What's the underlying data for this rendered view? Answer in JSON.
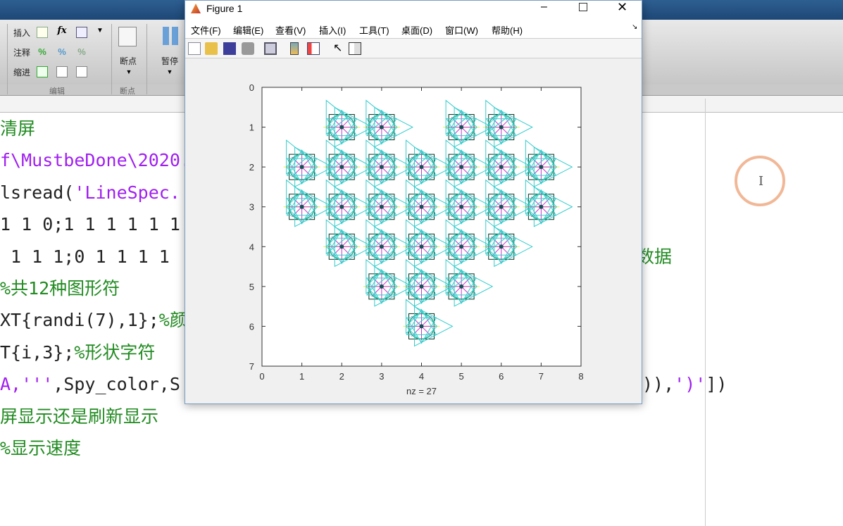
{
  "ribbon": {
    "rows": [
      {
        "label": "插入"
      },
      {
        "label": "注释"
      },
      {
        "label": "缩进"
      }
    ],
    "group_edit": "编辑",
    "breakpoint": "断点",
    "group_breakpoint": "断点",
    "pause": "暂停"
  },
  "editor": {
    "lines": [
      [
        {
          "t": "清屏",
          "c": "g"
        }
      ],
      [
        {
          "t": "f\\MustbeDone\\2020.",
          "c": "p"
        }
      ],
      [
        {
          "t": "lsread(",
          "c": "k"
        },
        {
          "t": "'LineSpec.",
          "c": "p"
        }
      ],
      [
        {
          "t": "1 1 0;1 1 1 1 1 1",
          "c": "k"
        }
      ],
      [
        {
          "t": " 1 1 1;0 1 1 1 1",
          "c": "k"
        }
      ],
      [
        {
          "t": "%共12种图形符",
          "c": "g"
        }
      ],
      [
        {
          "t": "XT{randi(7),1};",
          "c": "k"
        },
        {
          "t": "%颜",
          "c": "g"
        }
      ],
      [
        {
          "t": "T{i,3};",
          "c": "k"
        },
        {
          "t": "%形状字符",
          "c": "g"
        }
      ],
      [
        {
          "t": "A,'''",
          "c": "p"
        },
        {
          "t": ",Spy_color,S",
          "c": "k"
        }
      ],
      [
        {
          "t": "屏显示还是刷新显示",
          "c": "g"
        }
      ],
      [
        {
          "t": "%显示速度",
          "c": "g"
        }
      ]
    ],
    "right_fragments": [
      {
        "t": "数据",
        "c": "g"
      },
      {
        "t": ")),",
        "c": "k"
      },
      {
        "t": "')'",
        "c": "p"
      },
      {
        "t": "])",
        "c": "k"
      }
    ]
  },
  "figure": {
    "title": "Figure 1",
    "menu": [
      "文件(F)",
      "编辑(E)",
      "查看(V)",
      "插入(I)",
      "工具(T)",
      "桌面(D)",
      "窗口(W)",
      "帮助(H)"
    ],
    "toolbar": [
      "new-file-icon",
      "open-folder-icon",
      "save-icon",
      "print-icon",
      "link-plot-icon",
      "colorbar-icon",
      "legend-icon",
      "pointer-icon",
      "property-editor-icon"
    ]
  },
  "chart_data": {
    "type": "scatter",
    "xlabel": "nz = 27",
    "xlim": [
      0,
      8
    ],
    "ylim": [
      0,
      7
    ],
    "y_reversed": true,
    "xticks": [
      "0",
      "1",
      "2",
      "3",
      "4",
      "5",
      "6",
      "7",
      "8"
    ],
    "yticks": [
      "0",
      "1",
      "2",
      "3",
      "4",
      "5",
      "6",
      "7"
    ],
    "points": [
      [
        2,
        1
      ],
      [
        3,
        1
      ],
      [
        5,
        1
      ],
      [
        6,
        1
      ],
      [
        1,
        2
      ],
      [
        2,
        2
      ],
      [
        3,
        2
      ],
      [
        4,
        2
      ],
      [
        5,
        2
      ],
      [
        6,
        2
      ],
      [
        7,
        2
      ],
      [
        1,
        3
      ],
      [
        2,
        3
      ],
      [
        3,
        3
      ],
      [
        4,
        3
      ],
      [
        5,
        3
      ],
      [
        6,
        3
      ],
      [
        7,
        3
      ],
      [
        2,
        4
      ],
      [
        3,
        4
      ],
      [
        4,
        4
      ],
      [
        5,
        4
      ],
      [
        6,
        4
      ],
      [
        3,
        5
      ],
      [
        4,
        5
      ],
      [
        5,
        5
      ],
      [
        4,
        6
      ]
    ],
    "colors": {
      "triangles": "#33cccc",
      "star": "#cc33cc",
      "square": "#003322",
      "circle": "#22aa88",
      "line": "#eeee33"
    }
  }
}
